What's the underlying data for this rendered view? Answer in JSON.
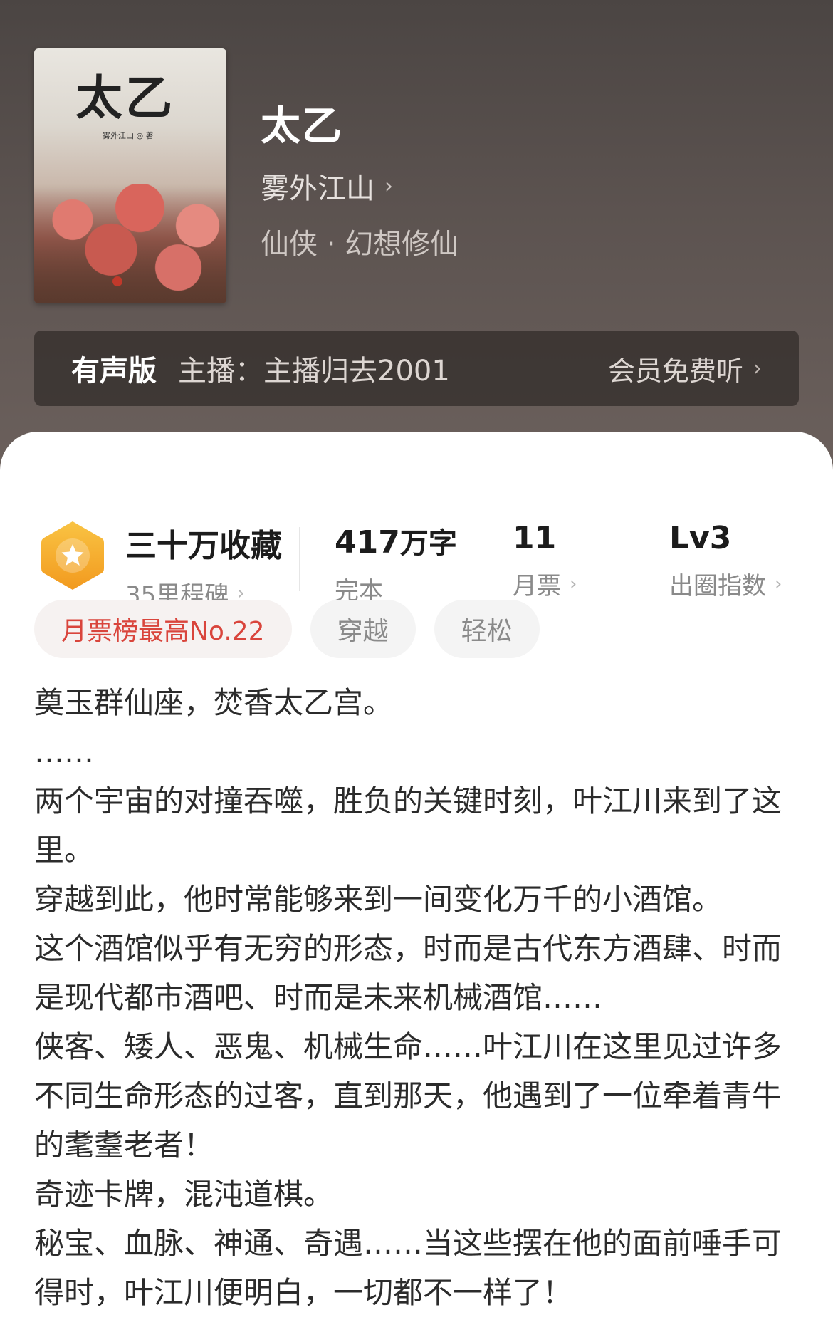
{
  "book": {
    "title": "太乙",
    "author": "雾外江山",
    "genre": "仙侠 · 幻想修仙",
    "cover_title": "太乙",
    "cover_author": "雾外江山 ◎ 著"
  },
  "audio": {
    "label": "有声版",
    "host": "主播：主播归去2001",
    "cta": "会员免费听"
  },
  "stats": {
    "collect_main": "三十万收藏",
    "collect_sub": "35里程碑",
    "words_num": "417",
    "words_unit": "万字",
    "words_sub": "完本",
    "tickets_main": "11",
    "tickets_sub": "月票",
    "level_main": "Lv3",
    "level_sub": "出圈指数"
  },
  "tags": [
    "月票榜最高No.22",
    "穿越",
    "轻松"
  ],
  "description": [
    "奠玉群仙座，焚香太乙宫。",
    "……",
    "两个宇宙的对撞吞噬，胜负的关键时刻，叶江川来到了这里。",
    "穿越到此，他时常能够来到一间变化万千的小酒馆。",
    "这个酒馆似乎有无穷的形态，时而是古代东方酒肆、时而是现代都市酒吧、时而是未来机械酒馆……",
    "侠客、矮人、恶鬼、机械生命……叶江川在这里见过许多不同生命形态的过客，直到那天，他遇到了一位牵着青牛的耄耋老者！",
    "奇迹卡牌，混沌道棋。",
    "秘宝、血脉、神通、奇遇……当这些摆在他的面前唾手可得时，叶江川便明白，一切都不一样了！"
  ],
  "colors": {
    "header_bg": "#5c5350",
    "accent_red": "#d9453c",
    "badge_orange": "#f5a623"
  }
}
